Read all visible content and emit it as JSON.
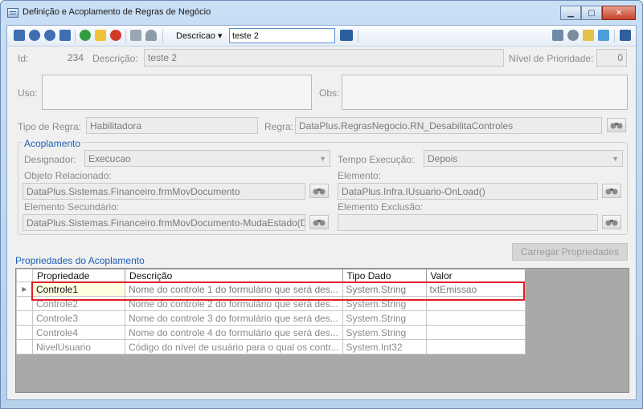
{
  "window": {
    "title": "Definição e Acoplamento de Regras de Negócio",
    "buttons": [
      "minimize",
      "maximize",
      "close"
    ]
  },
  "toolbar": {
    "dropdown_label": "Descricao",
    "search_value": "teste 2"
  },
  "header": {
    "id_label": "Id:",
    "id_value": "234",
    "descricao_label": "Descrição:",
    "descricao_value": "teste 2",
    "prioridade_label": "Nível de Prioridade:",
    "prioridade_value": "0",
    "uso_label": "Uso:",
    "obs_label": "Obs:",
    "tipo_label": "Tipo de Regra:",
    "tipo_value": "Habilitadora",
    "regra_label": "Regra:",
    "regra_value": "DataPlus.RegrasNegocio.RN_DesabilitaControles"
  },
  "acoplamento": {
    "title": "Acoplamento",
    "designador_label": "Designador:",
    "designador_value": "Execucao",
    "tempo_label": "Tempo Execução:",
    "tempo_value": "Depois",
    "objeto_label": "Objeto Relacionado:",
    "objeto_value": "DataPlus.Sistemas.Financeiro.frmMovDocumento",
    "elemento_label": "Elemento:",
    "elemento_value": "DataPlus.Infra.IUsuario-OnLoad()",
    "secundario_label": "Elemento Secundário:",
    "secundario_value": "DataPlus.Sistemas.Financeiro.frmMovDocumento-MudaEstado(D",
    "exclusao_label": "Elemento Exclusão:",
    "exclusao_value": ""
  },
  "propriedades": {
    "title": "Propriedades do Acoplamento",
    "load_button": "Carregar Propriedades",
    "columns": [
      "Propriedade",
      "Descrição",
      "Tipo Dado",
      "Valor"
    ],
    "rows": [
      {
        "propriedade": "Controle1",
        "descricao": "Nome do controle 1 do formulário que será des...",
        "tipo": "System.String",
        "valor": "txtEmissao"
      },
      {
        "propriedade": "Controle2",
        "descricao": "Nome do controle 2 do formulário que será des...",
        "tipo": "System.String",
        "valor": ""
      },
      {
        "propriedade": "Controle3",
        "descricao": "Nome do controle 3 do formulário que será des...",
        "tipo": "System.String",
        "valor": ""
      },
      {
        "propriedade": "Controle4",
        "descricao": "Nome do controle 4 do formulário que será des...",
        "tipo": "System.String",
        "valor": ""
      },
      {
        "propriedade": "NivelUsuario",
        "descricao": "Código do nível de usuário para o qual os contr...",
        "tipo": "System.Int32",
        "valor": ""
      }
    ],
    "current_row_marker": "▶"
  },
  "colors": {
    "accent_blue": "#1f5fb5",
    "highlight_red": "#e0202a",
    "selected_cell": "#ffffe1"
  },
  "icons": [
    "window-icon",
    "first-record-icon",
    "previous-record-icon",
    "next-record-icon",
    "last-record-icon",
    "add-icon",
    "edit-icon",
    "delete-icon",
    "save-icon",
    "undo-icon",
    "search-go-icon",
    "binoculars-icon"
  ]
}
